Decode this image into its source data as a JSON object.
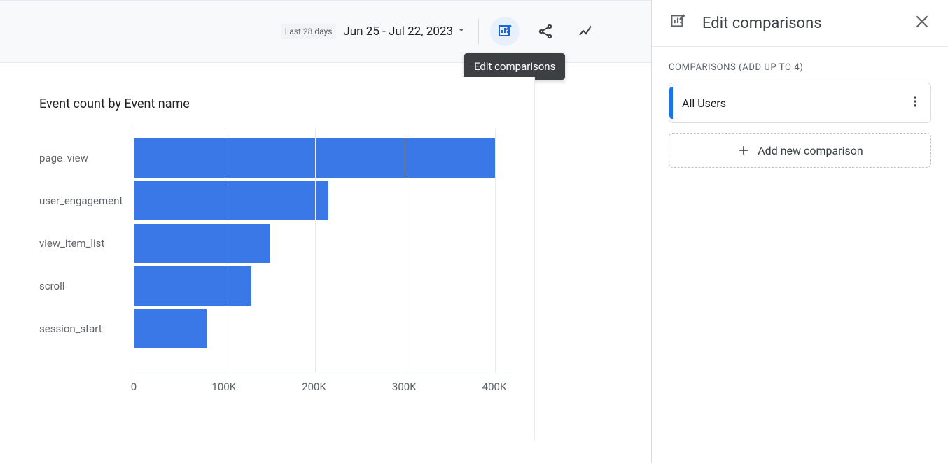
{
  "toolbar": {
    "period_label": "Last 28 days",
    "date_range": "Jun 25 - Jul 22, 2023",
    "tooltip": "Edit comparisons"
  },
  "card": {
    "title": "Event count by Event name"
  },
  "chart_data": {
    "type": "bar",
    "orientation": "horizontal",
    "title": "Event count by Event name",
    "xlabel": "",
    "ylabel": "",
    "categories": [
      "page_view",
      "user_engagement",
      "view_item_list",
      "scroll",
      "session_start"
    ],
    "values": [
      400000,
      215000,
      150000,
      130000,
      80000
    ],
    "xlim": [
      0,
      400000
    ],
    "x_ticks": [
      0,
      100000,
      200000,
      300000,
      400000
    ],
    "x_tick_labels": [
      "0",
      "100K",
      "200K",
      "300K",
      "400K"
    ],
    "bar_color": "#3b78e7"
  },
  "panel": {
    "title": "Edit comparisons",
    "section_label": "COMPARISONS (ADD UP TO 4)",
    "comparison_label": "All Users",
    "add_button": "Add new comparison"
  }
}
